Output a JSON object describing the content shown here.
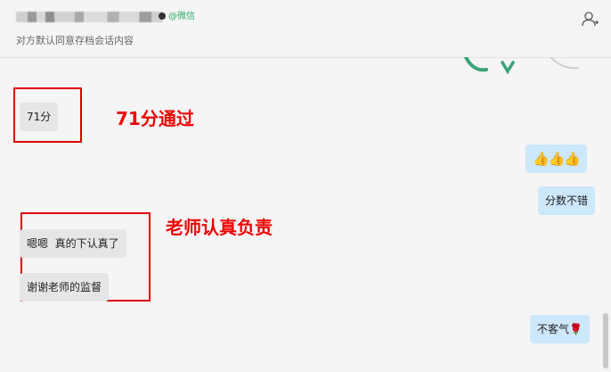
{
  "header": {
    "wechat_tag": "@微信",
    "subtitle": "对方默认同意存档会话内容"
  },
  "messages": {
    "m1": "71分",
    "m2": "👍👍👍",
    "m3": "分数不错",
    "m4": "嗯嗯  真的下认真了",
    "m5": "谢谢老师的监督",
    "m6": "不客气🌹"
  },
  "annotations": {
    "a1": "71分通过",
    "a2": "老师认真负责"
  },
  "colors": {
    "annotation_red": "#ee0000",
    "outgoing_bubble": "#cde7fb",
    "incoming_bubble": "#e6e6e6",
    "wechat_green": "#2aae67"
  },
  "icons": {
    "add_user": "add-user-icon",
    "sticker": "sticker-image"
  }
}
